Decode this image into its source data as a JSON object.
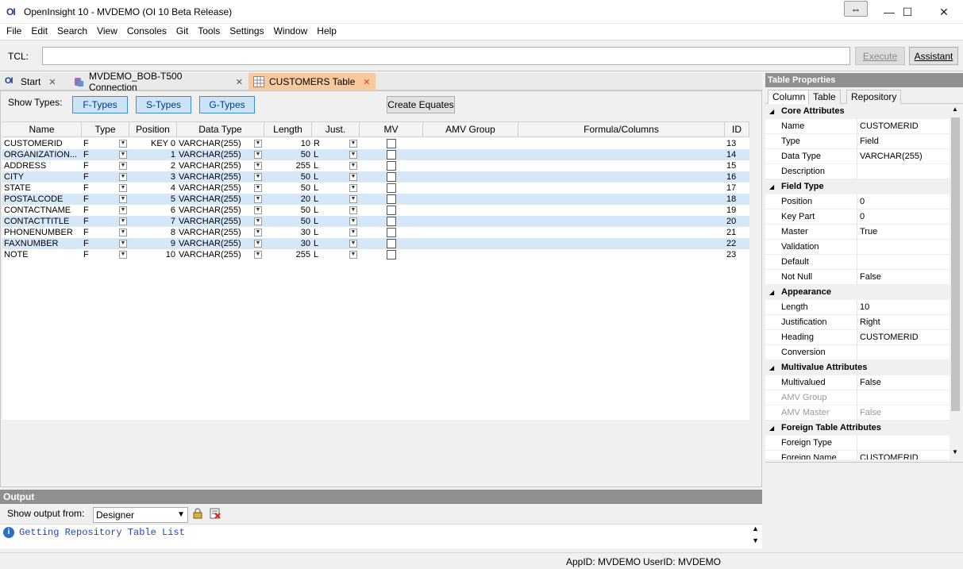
{
  "window": {
    "logo": "OI",
    "title": "OpenInsight 10 - MVDEMO (OI 10 Beta Release)",
    "snap_glyph": "⇔",
    "minimize_glyph": "—",
    "maximize_glyph": "☐",
    "close_glyph": "✕"
  },
  "menu": [
    "File",
    "Edit",
    "Search",
    "View",
    "Consoles",
    "Git",
    "Tools",
    "Settings",
    "Window",
    "Help"
  ],
  "tcl": {
    "label": "TCL:",
    "value": "",
    "execute": "Execute",
    "assistant": "Assistant"
  },
  "tabs": [
    {
      "label": "Start",
      "icon": "oi-logo-icon"
    },
    {
      "label": "MVDEMO_BOB-T500 Connection",
      "icon": "database-connection-icon"
    },
    {
      "label": "CUSTOMERS Table",
      "icon": "table-grid-icon"
    }
  ],
  "designer": {
    "show_types_label": "Show Types:",
    "ftypes": "F-Types",
    "stypes": "S-Types",
    "gtypes": "G-Types",
    "create_equates": "Create Equates"
  },
  "grid": {
    "columns": [
      "Name",
      "Type",
      "Position",
      "Data Type",
      "Length",
      "Just.",
      "MV",
      "AMV Group",
      "Formula/Columns",
      "ID"
    ],
    "rows": [
      {
        "name": "CUSTOMERID",
        "type": "F",
        "position": "KEY 0",
        "data_type": "VARCHAR(255)",
        "length": "10",
        "just": "R",
        "mv": false,
        "id": "13"
      },
      {
        "name": "ORGANIZATION...",
        "type": "F",
        "position": "1",
        "data_type": "VARCHAR(255)",
        "length": "50",
        "just": "L",
        "mv": false,
        "id": "14"
      },
      {
        "name": "ADDRESS",
        "type": "F",
        "position": "2",
        "data_type": "VARCHAR(255)",
        "length": "255",
        "just": "L",
        "mv": false,
        "id": "15"
      },
      {
        "name": "CITY",
        "type": "F",
        "position": "3",
        "data_type": "VARCHAR(255)",
        "length": "50",
        "just": "L",
        "mv": false,
        "id": "16"
      },
      {
        "name": "STATE",
        "type": "F",
        "position": "4",
        "data_type": "VARCHAR(255)",
        "length": "50",
        "just": "L",
        "mv": false,
        "id": "17"
      },
      {
        "name": "POSTALCODE",
        "type": "F",
        "position": "5",
        "data_type": "VARCHAR(255)",
        "length": "20",
        "just": "L",
        "mv": false,
        "id": "18"
      },
      {
        "name": "CONTACTNAME",
        "type": "F",
        "position": "6",
        "data_type": "VARCHAR(255)",
        "length": "50",
        "just": "L",
        "mv": false,
        "id": "19"
      },
      {
        "name": "CONTACTTITLE",
        "type": "F",
        "position": "7",
        "data_type": "VARCHAR(255)",
        "length": "50",
        "just": "L",
        "mv": false,
        "id": "20"
      },
      {
        "name": "PHONENUMBER",
        "type": "F",
        "position": "8",
        "data_type": "VARCHAR(255)",
        "length": "30",
        "just": "L",
        "mv": false,
        "id": "21"
      },
      {
        "name": "FAXNUMBER",
        "type": "F",
        "position": "9",
        "data_type": "VARCHAR(255)",
        "length": "30",
        "just": "L",
        "mv": false,
        "id": "22"
      },
      {
        "name": "NOTE",
        "type": "F",
        "position": "10",
        "data_type": "VARCHAR(255)",
        "length": "255",
        "just": "L",
        "mv": false,
        "id": "23"
      }
    ]
  },
  "output": {
    "header": "Output",
    "show_from_label": "Show output from:",
    "source": "Designer",
    "message": "Getting Repository Table List"
  },
  "status": {
    "appid": "AppID: MVDEMO",
    "userid": "UserID: MVDEMO"
  },
  "props": {
    "header": "Table Properties",
    "tabs": [
      "Column",
      "Table",
      "Repository"
    ],
    "rows": [
      {
        "cat": "Core Attributes"
      },
      {
        "name": "Name",
        "value": "CUSTOMERID"
      },
      {
        "name": "Type",
        "value": "Field"
      },
      {
        "name": "Data Type",
        "value": "VARCHAR(255)"
      },
      {
        "name": "Description",
        "value": ""
      },
      {
        "cat": "Field Type"
      },
      {
        "name": "Position",
        "value": "0"
      },
      {
        "name": "Key Part",
        "value": "0"
      },
      {
        "name": "Master",
        "value": "True"
      },
      {
        "name": "Validation",
        "value": ""
      },
      {
        "name": "Default",
        "value": ""
      },
      {
        "name": "Not Null",
        "value": "False"
      },
      {
        "cat": "Appearance"
      },
      {
        "name": "Length",
        "value": "10"
      },
      {
        "name": "Justification",
        "value": "Right"
      },
      {
        "name": "Heading",
        "value": "CUSTOMERID"
      },
      {
        "name": "Conversion",
        "value": ""
      },
      {
        "cat": "Multivalue Attributes"
      },
      {
        "name": "Multivalued",
        "value": "False"
      },
      {
        "name": "AMV Group",
        "value": "",
        "dim": true
      },
      {
        "name": "AMV Master",
        "value": "False",
        "dim": true
      },
      {
        "cat": "Foreign Table Attributes"
      },
      {
        "name": "Foreign Type",
        "value": ""
      },
      {
        "name": "Foreign Name",
        "value": "CUSTOMERID"
      }
    ]
  },
  "colors": {
    "active_tab": "#f9c99d",
    "alt_row": "#d6e8f8",
    "type_button": "#cce4f7",
    "panel_header": "#8f8f8f"
  }
}
